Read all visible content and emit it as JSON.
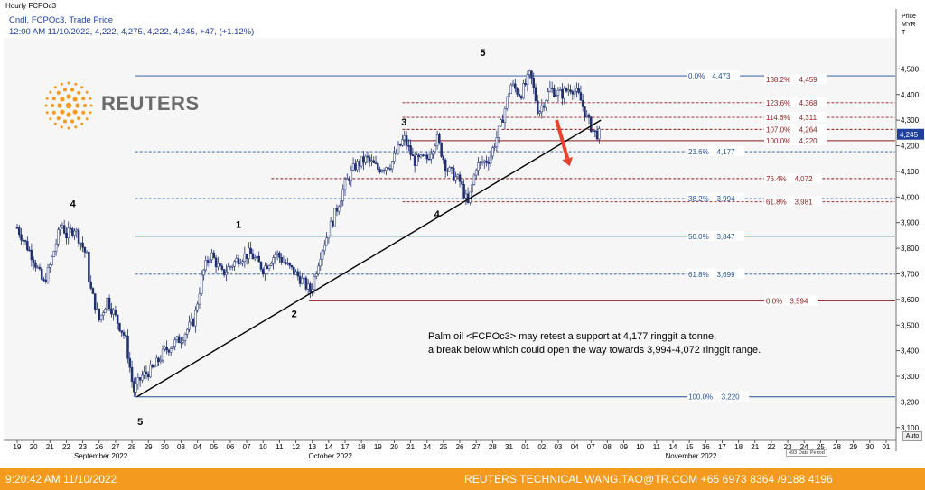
{
  "header": {
    "window_title": "Hourly FCPOc3",
    "line1": "Cndl, FCPOc3, Trade Price",
    "line2": "12:00 AM 11/10/2022, 4,222, 4,275, 4,222, 4,245, +47, (+1.12%)"
  },
  "logo": {
    "text": "REUTERS"
  },
  "price_axis": {
    "title_lines": [
      "Price",
      "MYR",
      "T"
    ],
    "auto_label": "Auto"
  },
  "data_period_label": "493 Data Period",
  "annotation": {
    "line1": "Palm oil <FCPOc3> may retest a support at 4,177 ringgit a tonne,",
    "line2": "a break below which could open the way towards 3,994-4,072 ringgit range."
  },
  "footer": {
    "time": "9:20:42 AM 11/10/2022",
    "credit": "REUTERS TECHNICAL  WANG.TAO@TR.COM  +65 6973 8364 /9188 4196",
    "background": "#f39a1f"
  },
  "chart_data": {
    "type": "candlestick",
    "ylim": [
      3050,
      4600
    ],
    "y_ticks": [
      3100,
      3200,
      3300,
      3400,
      3500,
      3600,
      3700,
      3800,
      3900,
      4000,
      4100,
      4200,
      4300,
      4400,
      4500
    ],
    "y_tick_labels": [
      "3,100",
      "3,200",
      "3,300",
      "3,400",
      "3,500",
      "3,600",
      "3,700",
      "3,800",
      "3,900",
      "4,000",
      "4,100",
      "4,200",
      "4,300",
      "4,400",
      "4,500"
    ],
    "last_price": {
      "value": 4245,
      "label": "4,245"
    },
    "x_ticks": [
      "19",
      "20",
      "21",
      "22",
      "23",
      "26",
      "27",
      "28",
      "29",
      "30",
      "03",
      "04",
      "05",
      "06",
      "07",
      "10",
      "11",
      "12",
      "13",
      "14",
      "17",
      "18",
      "19",
      "20",
      "21",
      "24",
      "25",
      "26",
      "27",
      "28",
      "31",
      "01",
      "02",
      "03",
      "04",
      "07",
      "08",
      "09",
      "10",
      "11",
      "14",
      "15",
      "16",
      "17",
      "18",
      "21",
      "22",
      "23",
      "24",
      "25",
      "28",
      "29",
      "30",
      "01"
    ],
    "month_labels": [
      {
        "label": "September 2022",
        "at_tick": 4
      },
      {
        "label": "October 2022",
        "at_tick": 18
      },
      {
        "label": "November 2022",
        "at_tick": 40
      }
    ],
    "price_path": [
      {
        "t": 0,
        "p": 3880
      },
      {
        "t": 1,
        "p": 3760
      },
      {
        "t": 1.6,
        "p": 3660
      },
      {
        "t": 2,
        "p": 3730
      },
      {
        "t": 2.7,
        "p": 3900
      },
      {
        "t": 3,
        "p": 3850
      },
      {
        "t": 3.5,
        "p": 3880
      },
      {
        "t": 4.3,
        "p": 3760
      },
      {
        "t": 4.4,
        "p": 3660
      },
      {
        "t": 5,
        "p": 3520
      },
      {
        "t": 5.5,
        "p": 3600
      },
      {
        "t": 6,
        "p": 3530
      },
      {
        "t": 6.6,
        "p": 3450
      },
      {
        "t": 7.1,
        "p": 3240
      },
      {
        "t": 7.6,
        "p": 3300
      },
      {
        "t": 8.3,
        "p": 3330
      },
      {
        "t": 9,
        "p": 3400
      },
      {
        "t": 10,
        "p": 3450
      },
      {
        "t": 10.8,
        "p": 3520
      },
      {
        "t": 11.3,
        "p": 3700
      },
      {
        "t": 11.8,
        "p": 3780
      },
      {
        "t": 12.5,
        "p": 3700
      },
      {
        "t": 13.5,
        "p": 3760
      },
      {
        "t": 14.2,
        "p": 3780
      },
      {
        "t": 15,
        "p": 3720
      },
      {
        "t": 15.8,
        "p": 3780
      },
      {
        "t": 16.5,
        "p": 3730
      },
      {
        "t": 17.3,
        "p": 3680
      },
      {
        "t": 17.9,
        "p": 3630
      },
      {
        "t": 18.5,
        "p": 3780
      },
      {
        "t": 19.2,
        "p": 3900
      },
      {
        "t": 20,
        "p": 4050
      },
      {
        "t": 20.6,
        "p": 4120
      },
      {
        "t": 21.3,
        "p": 4150
      },
      {
        "t": 22,
        "p": 4110
      },
      {
        "t": 22.8,
        "p": 4130
      },
      {
        "t": 23.6,
        "p": 4230
      },
      {
        "t": 24.2,
        "p": 4140
      },
      {
        "t": 25,
        "p": 4150
      },
      {
        "t": 25.6,
        "p": 4230
      },
      {
        "t": 26.2,
        "p": 4110
      },
      {
        "t": 27,
        "p": 4060
      },
      {
        "t": 27.5,
        "p": 3970
      },
      {
        "t": 28,
        "p": 4120
      },
      {
        "t": 28.8,
        "p": 4150
      },
      {
        "t": 29.5,
        "p": 4280
      },
      {
        "t": 30.1,
        "p": 4440
      },
      {
        "t": 30.7,
        "p": 4400
      },
      {
        "t": 31.3,
        "p": 4480
      },
      {
        "t": 31.8,
        "p": 4330
      },
      {
        "t": 32.5,
        "p": 4420
      },
      {
        "t": 33.2,
        "p": 4400
      },
      {
        "t": 33.8,
        "p": 4430
      },
      {
        "t": 34.3,
        "p": 4390
      },
      {
        "t": 34.8,
        "p": 4300
      },
      {
        "t": 35.2,
        "p": 4250
      },
      {
        "t": 35.5,
        "p": 4245
      }
    ],
    "trendline": {
      "from": {
        "t": 7.3,
        "p": 3220
      },
      "to": {
        "t": 35.6,
        "p": 4300
      }
    },
    "fib_levels": [
      {
        "pct": "0.0%",
        "value": 4473,
        "label": "4,473",
        "color": "#1f4e96",
        "style": "solid",
        "x_start_tick": 7.2
      },
      {
        "pct": "138.2%",
        "value": 4459,
        "label": "4,459",
        "color": "#8b1a1a",
        "style": "none",
        "x_start_tick": 7.2
      },
      {
        "pct": "123.6%",
        "value": 4368,
        "label": "4,368",
        "color": "#8b1a1a",
        "style": "dashed",
        "x_start_tick": 23.5
      },
      {
        "pct": "114.6%",
        "value": 4311,
        "label": "4,311",
        "color": "#8b1a1a",
        "style": "dashed",
        "x_start_tick": 23.5
      },
      {
        "pct": "107.0%",
        "value": 4264,
        "label": "4,264",
        "color": "#8b1a1a",
        "style": "dashed",
        "x_start_tick": 23.5
      },
      {
        "pct": "100.0%",
        "value": 4220,
        "label": "4,220",
        "color": "#8b1a1a",
        "style": "solid",
        "x_start_tick": 23.5
      },
      {
        "pct": "23.6%",
        "value": 4177,
        "label": "4,177",
        "color": "#1f4e96",
        "style": "dashed",
        "x_start_tick": 7.2
      },
      {
        "pct": "76.4%",
        "value": 4072,
        "label": "4,072",
        "color": "#8b1a1a",
        "style": "dashed",
        "x_start_tick": 15.5
      },
      {
        "pct": "38.2%",
        "value": 3994,
        "label": "3,994",
        "color": "#1f4e96",
        "style": "dashed",
        "x_start_tick": 7.2
      },
      {
        "pct": "61.8%",
        "value": 3981,
        "label": "3,981",
        "color": "#8b1a1a",
        "style": "dashed",
        "x_start_tick": 23.5
      },
      {
        "pct": "50.0%",
        "value": 3847,
        "label": "3,847",
        "color": "#1f4e96",
        "style": "solid",
        "x_start_tick": 7.2
      },
      {
        "pct": "61.8%",
        "value": 3699,
        "label": "3,699",
        "color": "#1f4e96",
        "style": "dashed",
        "x_start_tick": 7.2
      },
      {
        "pct": "0.0%",
        "value": 3594,
        "label": "3,594",
        "color": "#8b1a1a",
        "style": "solid",
        "x_start_tick": 17.8
      },
      {
        "pct": "100.0%",
        "value": 3220,
        "label": "3,220",
        "color": "#1f4e96",
        "style": "solid",
        "x_start_tick": 7.2
      }
    ],
    "wave_labels": [
      {
        "label": "4",
        "t": 3.4,
        "p": 3960
      },
      {
        "label": "5",
        "t": 7.5,
        "p": 3110
      },
      {
        "label": "1",
        "t": 13.5,
        "p": 3880
      },
      {
        "label": "2",
        "t": 16.9,
        "p": 3530
      },
      {
        "label": "3",
        "t": 23.6,
        "p": 4280
      },
      {
        "label": "4",
        "t": 25.6,
        "p": 3920
      },
      {
        "label": "5",
        "t": 28.4,
        "p": 4550
      }
    ],
    "forecast_arrow": {
      "color": "#e8412c",
      "from": {
        "t": 32.9,
        "p": 4300
      },
      "to": {
        "t": 33.7,
        "p": 4120
      }
    }
  }
}
